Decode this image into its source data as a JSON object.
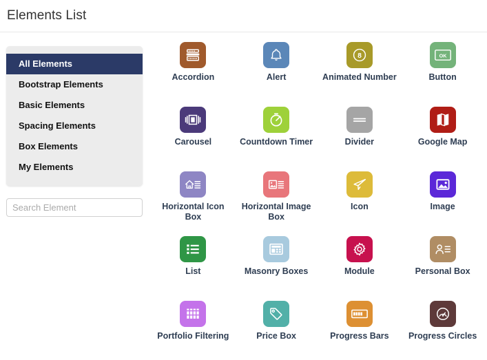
{
  "header": {
    "title": "Elements List"
  },
  "sidebar": {
    "categories": [
      {
        "label": "All Elements",
        "active": true
      },
      {
        "label": "Bootstrap Elements",
        "active": false
      },
      {
        "label": "Basic Elements",
        "active": false
      },
      {
        "label": "Spacing Elements",
        "active": false
      },
      {
        "label": "Box Elements",
        "active": false
      },
      {
        "label": "My Elements",
        "active": false
      }
    ],
    "search": {
      "placeholder": "Search Element",
      "value": ""
    },
    "active_color": "#2b3a67",
    "panel_color": "#ececec"
  },
  "elements": [
    {
      "label": "Accordion",
      "icon": "accordion-icon",
      "color": "#a05a2c"
    },
    {
      "label": "Alert",
      "icon": "bell-icon",
      "color": "#5b87b8"
    },
    {
      "label": "Animated Number",
      "icon": "numbered-circle-icon",
      "color": "#a89a29"
    },
    {
      "label": "Button",
      "icon": "ok-button-icon",
      "color": "#74b37a"
    },
    {
      "label": "Carousel",
      "icon": "carousel-icon",
      "color": "#4b3a7a"
    },
    {
      "label": "Countdown Timer",
      "icon": "stopwatch-icon",
      "color": "#9ed13a"
    },
    {
      "label": "Divider",
      "icon": "divider-icon",
      "color": "#a5a5a5"
    },
    {
      "label": "Google Map",
      "icon": "folded-map-icon",
      "color": "#b01d16"
    },
    {
      "label": "Horizontal Icon Box",
      "icon": "home-with-lines-icon",
      "color": "#8e86c4"
    },
    {
      "label": "Horizontal Image Box",
      "icon": "image-with-lines-icon",
      "color": "#e8767b"
    },
    {
      "label": "Icon",
      "icon": "paper-plane-icon",
      "color": "#ddbb3a"
    },
    {
      "label": "Image",
      "icon": "picture-icon",
      "color": "#5b28d8"
    },
    {
      "label": "List",
      "icon": "list-icon",
      "color": "#2f9646"
    },
    {
      "label": "Masonry Boxes",
      "icon": "grid-boxes-icon",
      "color": "#a8cade"
    },
    {
      "label": "Module",
      "icon": "gear-icon",
      "color": "#c7114e"
    },
    {
      "label": "Personal Box",
      "icon": "person-with-lines-icon",
      "color": "#b08d64"
    },
    {
      "label": "Portfolio Filtering",
      "icon": "portfolio-grid-icon",
      "color": "#c473ea"
    },
    {
      "label": "Price Box",
      "icon": "price-tag-icon",
      "color": "#52b0a8"
    },
    {
      "label": "Progress Bars",
      "icon": "progress-bar-icon",
      "color": "#dd9033"
    },
    {
      "label": "Progress Circles",
      "icon": "gauge-icon",
      "color": "#5e3a3a"
    }
  ]
}
